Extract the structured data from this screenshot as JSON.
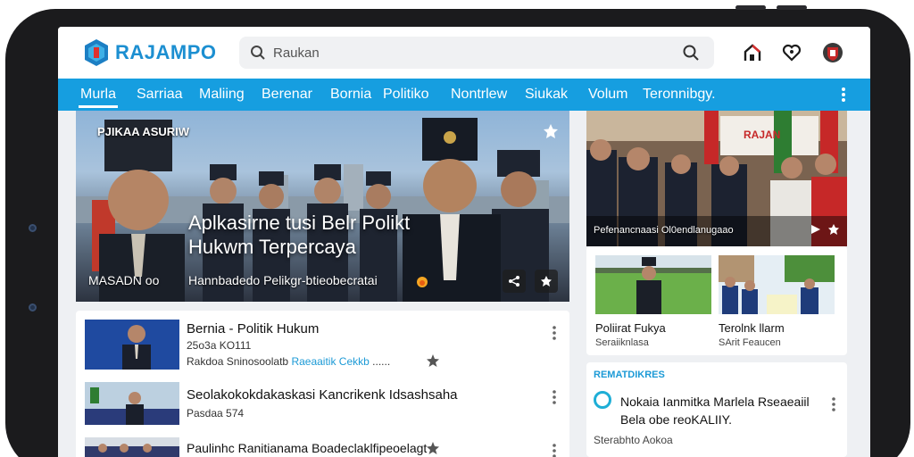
{
  "app": {
    "brand": "RAJAMPO",
    "brand_color": "#1c8fd1",
    "nav_color": "#169ee0",
    "accent_link": "#1c9ad6"
  },
  "header": {
    "search_placeholder": "Raukan",
    "icons": [
      "search-icon",
      "home-icon",
      "heart-icon",
      "profile-badge-icon"
    ]
  },
  "nav": {
    "items": [
      "Murla",
      "Sarriaa",
      "Maliing",
      "Berenar",
      "Bornia",
      "Politiko",
      "Nontrlew",
      "Siukak",
      "Volum",
      "Teronnibgy."
    ],
    "active_index": 0
  },
  "hero": {
    "kicker": "PJIKAA ASURIW",
    "title": "Aplkasirne tusi Belr Polikt Hukwm Terpercaya",
    "source": "MASADN oo",
    "caption": "Hannbadedo Pelikgr-btieobecratai"
  },
  "list": [
    {
      "title": "Bernia - Politik Hukum",
      "date": "25o3a KO111",
      "meta_prefix": "Rakdoa Sninosoolatb",
      "meta_link": "Raeaaitik Cekkb",
      "meta_suffix": "......"
    },
    {
      "title": "Seolakokokdakaskasi Kancrikenk Idsashsaha",
      "date": "Pasdaa 574",
      "meta_prefix": "",
      "meta_link": "",
      "meta_suffix": ""
    },
    {
      "title": "Paulinhc Ranitianama Boadeclaklfipeoelagt",
      "date": "",
      "meta_prefix": "",
      "meta_link": "",
      "meta_suffix": ""
    }
  ],
  "side": {
    "photo_caption": "Pefenancnaasi Ol0endlanugaao",
    "photo_banner": "RAJAN"
  },
  "mini_cards": [
    {
      "title": "Poliirat Fukya",
      "sub": "Seraiiknlasa"
    },
    {
      "title": "Terolnk llarm",
      "sub": "SArit Feaucen"
    }
  ],
  "trending": {
    "heading": "REMATDIKRES",
    "title": "Nokaia Ianmitka Marlela Rseaeaiil Bela obe reoKALIIY.",
    "sub": "Sterabhto Aokoa"
  }
}
